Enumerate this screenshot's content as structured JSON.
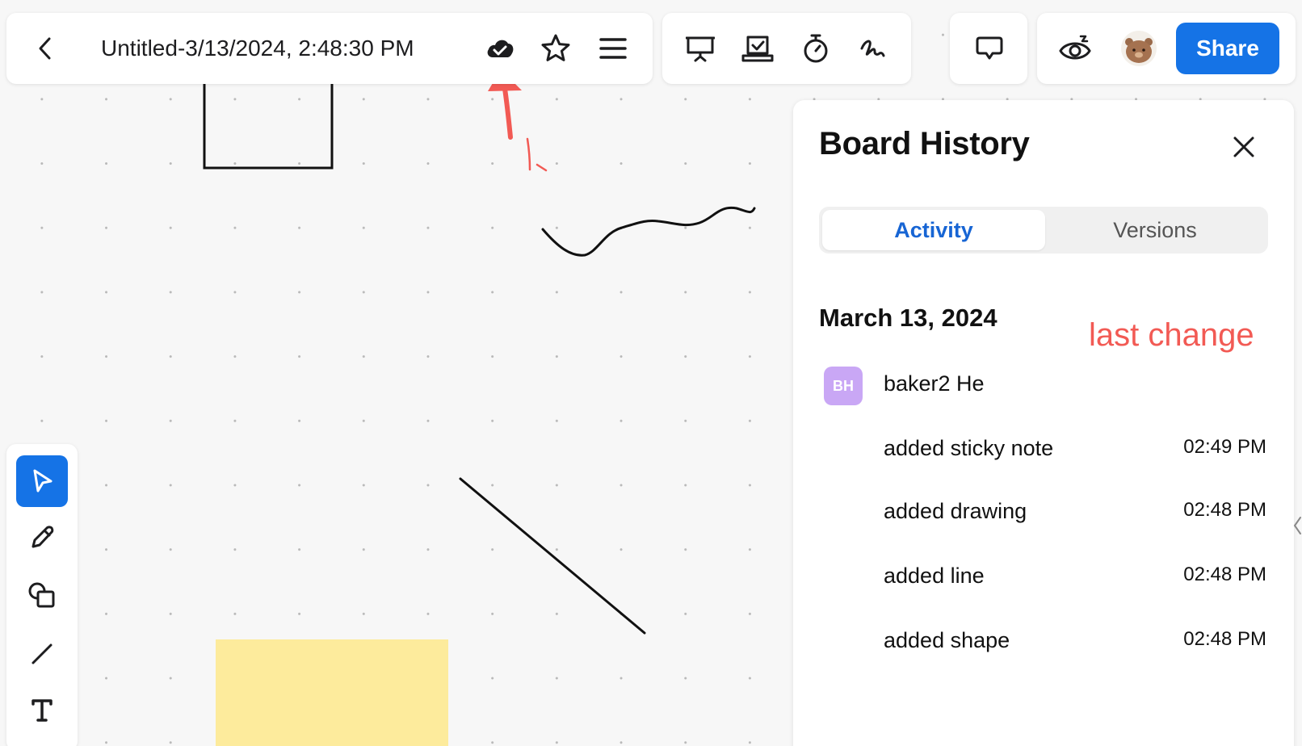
{
  "header": {
    "title": "Untitled-3/13/2024, 2:48:30 PM",
    "share_label": "Share"
  },
  "icons": {
    "back": "chevron-left-icon",
    "cloud_saved": "cloud-check-icon",
    "star": "star-icon",
    "menu": "menu-icon",
    "present": "presentation-icon",
    "vote": "voting-icon",
    "timer": "timer-icon",
    "signature": "signature-icon",
    "comments": "comment-icon",
    "follow": "eye-icon",
    "close": "close-icon"
  },
  "panel": {
    "title": "Board History",
    "tabs": [
      {
        "label": "Activity",
        "active": true
      },
      {
        "label": "Versions",
        "active": false
      }
    ],
    "date": "March 13, 2024",
    "user": {
      "initials": "BH",
      "name": "baker2 He"
    },
    "activities": [
      {
        "action": "added sticky note",
        "time": "02:49 PM"
      },
      {
        "action": "added drawing",
        "time": "02:48 PM"
      },
      {
        "action": "added line",
        "time": "02:48 PM"
      },
      {
        "action": "added shape",
        "time": "02:48 PM"
      }
    ]
  },
  "annotations": {
    "label": "last change",
    "color": "#f25a54"
  },
  "toolbar": {
    "tools": [
      "select-tool",
      "pen-tool",
      "shape-tool",
      "line-tool",
      "text-tool"
    ],
    "active": "select-tool"
  },
  "colors": {
    "accent": "#1573e6",
    "sticky_note": "#fdeb9c",
    "avatar": "#c9a7f5"
  }
}
